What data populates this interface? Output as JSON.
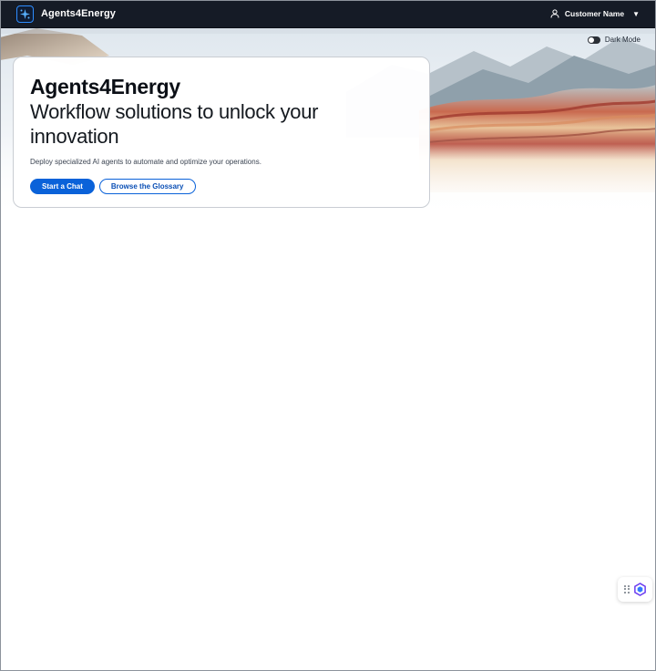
{
  "header": {
    "app_title": "Agents4Energy",
    "logo_icon": "sparkle-grid-icon",
    "user_icon": "user-icon",
    "user_name": "Customer Name",
    "user_menu_icon": "caret-down-icon"
  },
  "theme_toggle": {
    "label": "Dark Mode",
    "enabled": false
  },
  "hero": {
    "title": "Agents4Energy",
    "subtitle": "Workflow solutions to unlock your innovation",
    "description": "Deploy specialized AI agents to automate and optimize your operations.",
    "primary_button": "Start a Chat",
    "secondary_button": "Browse the Glossary"
  },
  "widget": {
    "grip_icon": "drag-grip-icon",
    "assistant_icon": "hexagon-assistant-icon"
  },
  "colors": {
    "header_bg": "#151b26",
    "primary": "#0a62d9",
    "background": "#ffffff"
  }
}
